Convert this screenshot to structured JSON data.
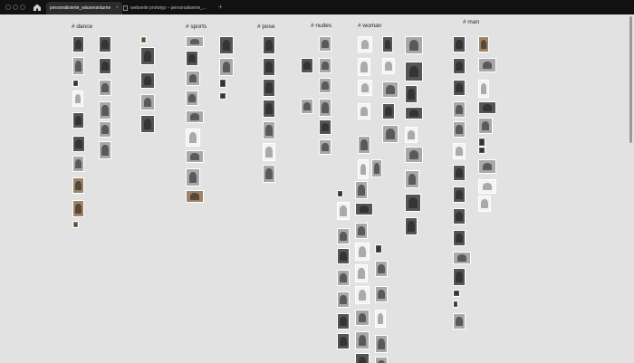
{
  "tabs": [
    {
      "label": "personalisierte_wissensräume",
      "active": true,
      "close": "×"
    },
    {
      "label": "webseite prototyp – personalisierte_...",
      "active": false
    }
  ],
  "new_tab_label": "+",
  "icons": {
    "home": "home-icon",
    "tab_page": "page-icon"
  },
  "tags": {
    "dance": "# dance",
    "sports": "# sports",
    "pose": "# pose",
    "nudes": "# nudes",
    "woman": "# woman",
    "man": "# man"
  },
  "colors": {
    "titlebar": "#0d0d0d",
    "active_tab": "#2c2c2c",
    "canvas": "#e2e2e2",
    "thumb_border": "#ffffff"
  }
}
